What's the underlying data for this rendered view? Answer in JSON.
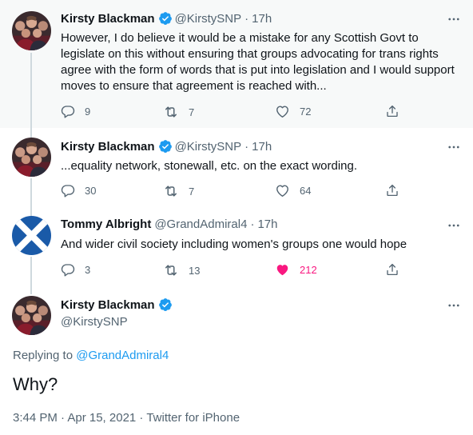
{
  "tweets": [
    {
      "name": "Kirsty Blackman",
      "verified": true,
      "handle": "@KirstySNP",
      "time": "17h",
      "text": "However, I do believe it would be a mistake for any Scottish Govt to\nlegislate on this without ensuring that groups advocating for trans rights\nagree with the form of words that is put into legislation and I would support\nmoves to ensure that agreement is reached with...",
      "replies": "9",
      "retweets": "7",
      "likes": "72"
    },
    {
      "name": "Kirsty Blackman",
      "verified": true,
      "handle": "@KirstySNP",
      "time": "17h",
      "text": "...equality network, stonewall, etc. on the exact wording.",
      "replies": "30",
      "retweets": "7",
      "likes": "64"
    },
    {
      "name": "Tommy Albright",
      "verified": false,
      "handle": "@GrandAdmiral4",
      "time": "17h",
      "text": "And wider civil society including women's groups one would hope",
      "replies": "3",
      "retweets": "13",
      "likes": "212",
      "liked": true
    }
  ],
  "focus": {
    "name": "Kirsty Blackman",
    "handle": "@KirstySNP",
    "replying_prefix": "Replying to ",
    "replying_to": "@GrandAdmiral4",
    "text": "Why?",
    "meta": "3:44 PM · Apr 15, 2021 · Twitter for iPhone"
  },
  "colors": {
    "accent": "#1d9bf0",
    "like": "#f91880",
    "muted": "#536471",
    "highlight_bg": "#f7f9f9",
    "saltire_blue": "#1a5aa8"
  },
  "icons": [
    "verified-badge-icon",
    "more-icon",
    "reply-icon",
    "retweet-icon",
    "like-icon",
    "share-icon"
  ]
}
